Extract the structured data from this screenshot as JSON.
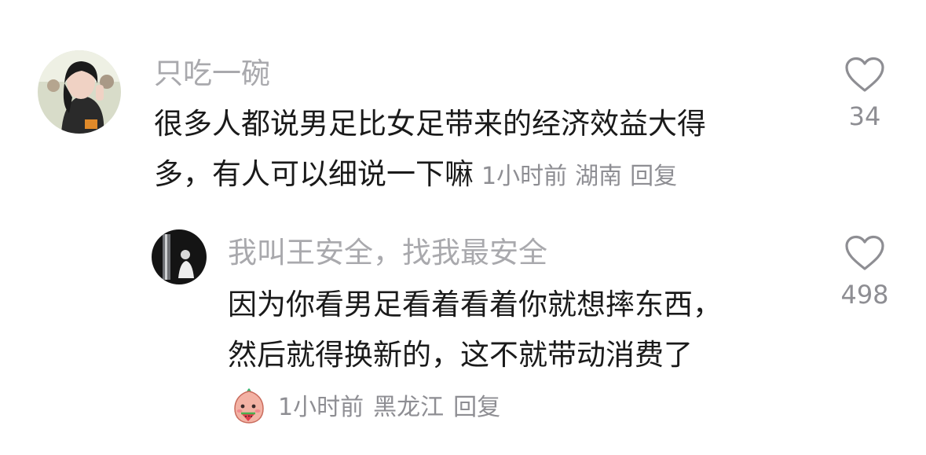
{
  "comment": {
    "username": "只吃一碗",
    "text_line1": "很多人都说男足比女足带来的经济效益大得",
    "text_line2": "多，有人可以细说一下嘛",
    "time": "1小时前",
    "location": "湖南",
    "reply_label": "回复",
    "likes": "34"
  },
  "reply": {
    "username": "我叫王安全，找我最安全",
    "text_line1": "因为你看男足看着看着你就想摔东西，",
    "text_line2": "然后就得换新的，这不就带动消费了",
    "time": "1小时前",
    "location": "黑龙江",
    "reply_label": "回复",
    "likes": "498"
  },
  "colors": {
    "username": "#a9a9ad",
    "text": "#1a1a1a",
    "meta": "#8e8e93",
    "heart_stroke": "#8e8e93"
  },
  "icons": {
    "like": "heart-outline-icon",
    "reaction": "watermelon-face-emoji"
  }
}
